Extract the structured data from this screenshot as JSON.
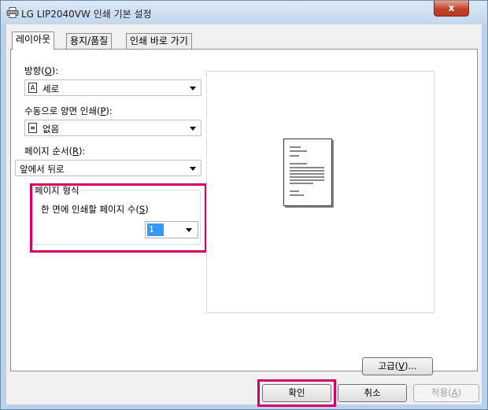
{
  "window": {
    "title": "LG LIP2040VW 인쇄 기본 설정",
    "close_label": "x"
  },
  "tabs": [
    {
      "label": "레이아웃",
      "active": true
    },
    {
      "label": "용지/품질",
      "active": false
    },
    {
      "label": "인쇄 바로 가기",
      "active": false
    }
  ],
  "orientation": {
    "label_prefix": "방향(",
    "label_key": "O",
    "label_suffix": "):",
    "value": "세로",
    "icon": "portrait-page-icon"
  },
  "duplex": {
    "label_prefix": "수동으로 양면 인쇄(",
    "label_key": "P",
    "label_suffix": "):",
    "value": "없음",
    "icon": "single-page-icon"
  },
  "page_order": {
    "label_prefix": "페이지 순서(",
    "label_key": "R",
    "label_suffix": "):",
    "value": "앞에서 뒤로"
  },
  "page_format": {
    "group_title": "페이지 형식",
    "pages_per_sheet_prefix": "한 면에 인쇄할 페이지 수(",
    "pages_per_sheet_key": "S",
    "pages_per_sheet_suffix": ")",
    "pages_per_sheet_value": "1"
  },
  "buttons": {
    "advanced_prefix": "고급(",
    "advanced_key": "V",
    "advanced_suffix": ")...",
    "ok": "확인",
    "cancel": "취소",
    "apply_prefix": "적용(",
    "apply_key": "A",
    "apply_suffix": ")"
  },
  "colors": {
    "highlight": "#d4006a",
    "selection": "#3399ff"
  }
}
